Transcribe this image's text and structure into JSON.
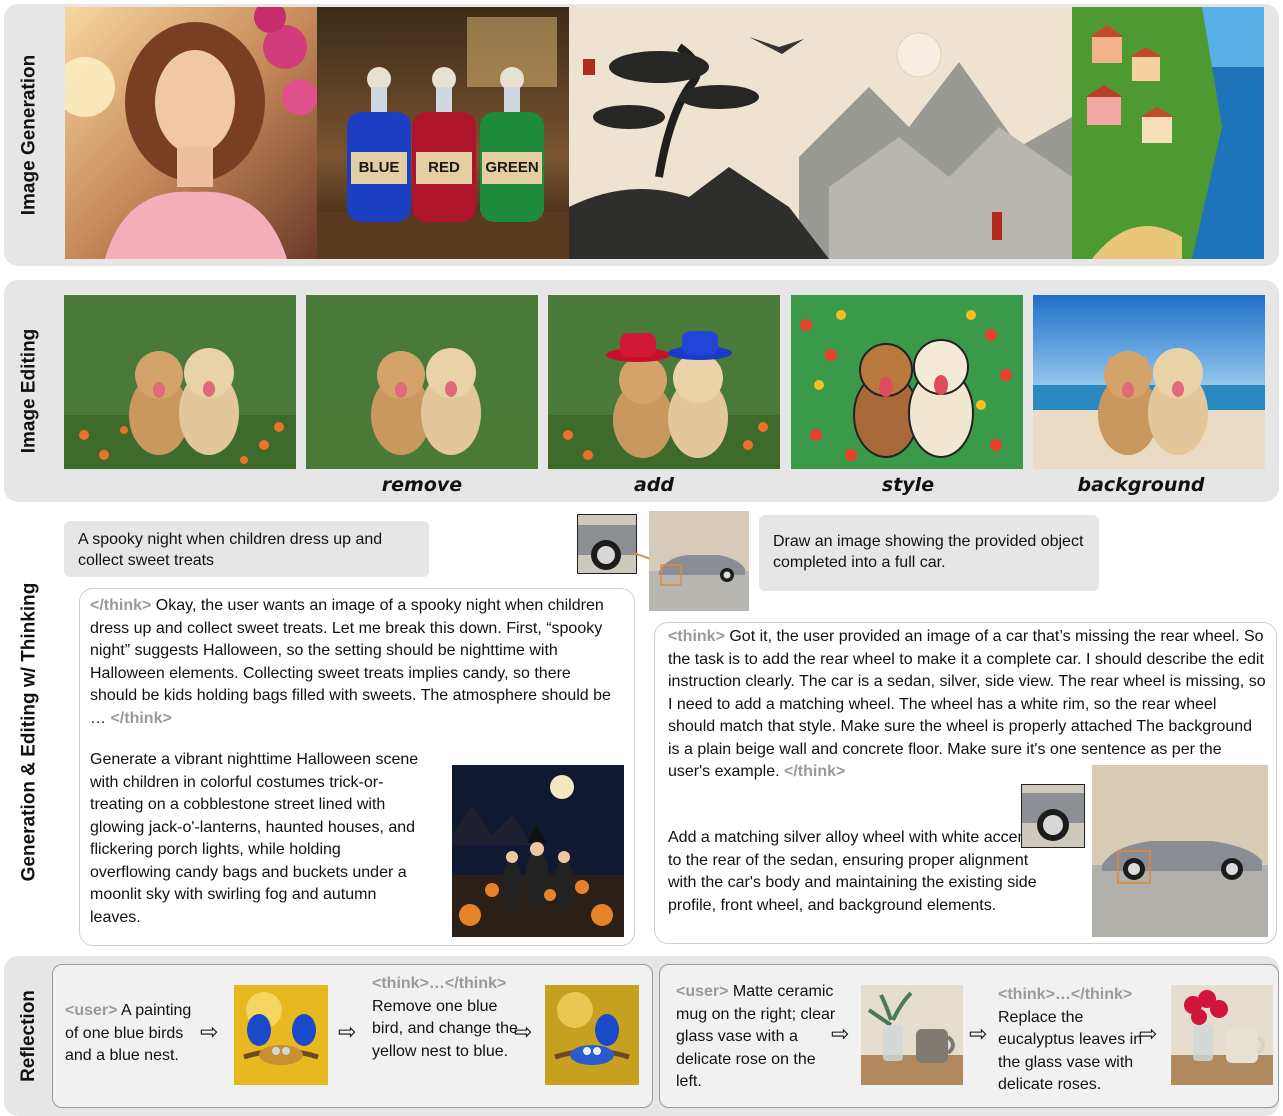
{
  "labels": {
    "generation": "Image Generation",
    "editing": "Image Editing",
    "thinking": "Generation & Editing w/ Thinking",
    "reflection": "Reflection"
  },
  "generation": {
    "bottles": [
      "BLUE",
      "RED",
      "GREEN"
    ]
  },
  "editing": {
    "ops": [
      "remove",
      "add",
      "style",
      "background"
    ]
  },
  "thinking": {
    "left": {
      "prompt": "A spooky night when children dress up and collect sweet treats",
      "think_open": "</think>",
      "think_text": " Okay, the user wants an image of a spooky night when children dress up and collect sweet treats. Let me break this down. First, “spooky night” suggests Halloween, so the setting should be nighttime with Halloween elements. Collecting sweet treats implies candy, so there should be kids holding bags filled with sweets. The atmosphere should be … ",
      "think_close": "</think>",
      "output": "Generate a vibrant nighttime Halloween scene with children in colorful costumes trick-or-treating on a cobblestone street lined with glowing jack-o'-lanterns, haunted houses, and flickering porch lights, while holding overflowing candy bags and buckets under a moonlit sky with swirling fog and autumn leaves."
    },
    "right": {
      "prompt": "Draw an image showing the provided object completed into a full car.",
      "think_open": "<think>",
      "think_text": " Got it, the user provided an image of a car that’s missing the rear wheel. So the task is to add the rear wheel to make it a complete car. I should describe the edit instruction clearly. The car is a sedan, silver, side view. The rear wheel is missing, so I need to add a matching wheel. The wheel has a white rim, so the rear wheel should match that style. Make sure the wheel is properly attached The background is a plain beige wall and concrete floor. Make sure it's one sentence as per the user's example. ",
      "think_close": "</think>",
      "output": "Add a matching silver alloy wheel with white accents to the rear of the sedan, ensuring proper alignment with the car's body and maintaining the existing side profile, front wheel, and background elements."
    }
  },
  "reflection": {
    "left": {
      "user_tag": "<user>",
      "user_text": " A painting of one blue birds and a blue nest.",
      "think_tag": "<think>…</think>",
      "edit_text": "Remove one blue bird, and change the yellow nest to blue."
    },
    "right": {
      "user_tag": "<user>",
      "user_text": " Matte ceramic mug on the right; clear glass vase with a delicate rose on the left.",
      "think_tag": "<think>…</think>",
      "edit_text": "Replace the eucalyptus leaves in the glass vase with delicate roses."
    }
  },
  "arrow_glyph": "⇨",
  "colors": {
    "band": "#e6e6e6",
    "think_tag": "#9a9a9a",
    "accent_line": "#e08a3a"
  }
}
